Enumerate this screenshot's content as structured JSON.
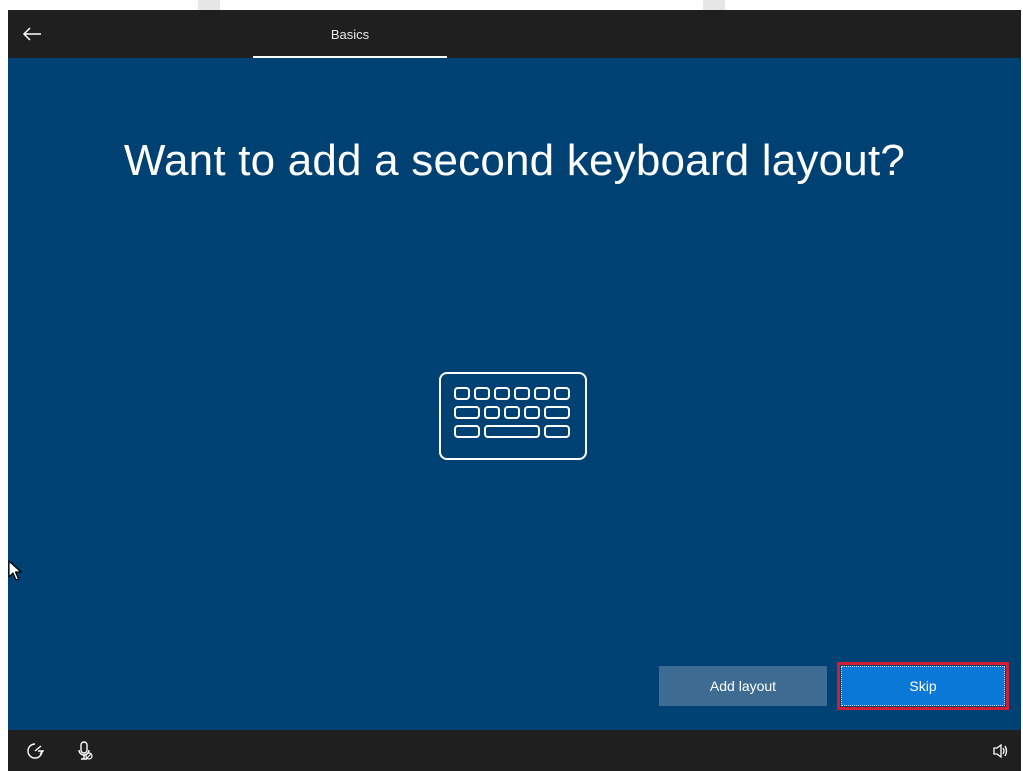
{
  "topbar": {
    "back_icon": "arrow-left-icon",
    "tab_label": "Basics"
  },
  "main": {
    "heading": "Want to add a second keyboard layout?",
    "illustration_icon": "keyboard-icon"
  },
  "actions": {
    "add_layout_label": "Add layout",
    "skip_label": "Skip"
  },
  "bottombar": {
    "left_icons": [
      "ease-of-access-icon",
      "microphone-off-icon"
    ],
    "right_icons": [
      "volume-icon"
    ]
  },
  "colors": {
    "background": "#004173",
    "bar": "#1f1f1f",
    "primary_button": "#0a78d7",
    "secondary_button": "#3d6b92",
    "highlight": "#d11e35"
  }
}
